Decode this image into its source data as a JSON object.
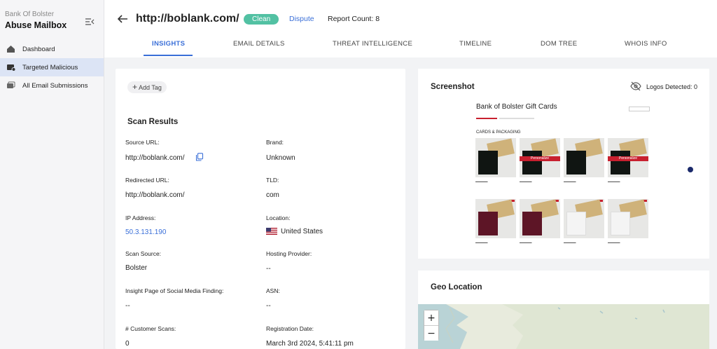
{
  "sidebar": {
    "org": "Bank Of Bolster",
    "app_title": "Abuse Mailbox",
    "items": [
      {
        "label": "Dashboard"
      },
      {
        "label": "Targeted Malicious"
      },
      {
        "label": "All Email Submissions"
      }
    ]
  },
  "header": {
    "url": "http://boblank.com/",
    "status_badge": "Clean",
    "dispute": "Dispute",
    "report_count": "Report Count: 8"
  },
  "tabs": [
    {
      "label": "INSIGHTS"
    },
    {
      "label": "EMAIL DETAILS"
    },
    {
      "label": "THREAT INTELLIGENCE"
    },
    {
      "label": "TIMELINE"
    },
    {
      "label": "DOM TREE"
    },
    {
      "label": "WHOIS INFO"
    }
  ],
  "insights": {
    "add_tag": "Add Tag",
    "scan_results_title": "Scan Results",
    "fields": {
      "source_url": {
        "label": "Source URL:",
        "value": "http://boblank.com/"
      },
      "brand": {
        "label": "Brand:",
        "value": "Unknown"
      },
      "redirected_url": {
        "label": "Redirected URL:",
        "value": "http://boblank.com/"
      },
      "tld": {
        "label": "TLD:",
        "value": "com"
      },
      "ip_address": {
        "label": "IP Address:",
        "value": "50.3.131.190"
      },
      "location": {
        "label": "Location:",
        "value": "United States"
      },
      "scan_source": {
        "label": "Scan Source:",
        "value": "Bolster"
      },
      "hosting_provider": {
        "label": "Hosting Provider:",
        "value": "--"
      },
      "insight_page": {
        "label": "Insight Page of Social Media Finding:",
        "value": "--"
      },
      "asn": {
        "label": "ASN:",
        "value": "--"
      },
      "customer_scans": {
        "label": "# Customer Scans:",
        "value": "0"
      },
      "registration_date": {
        "label": "Registration Date:",
        "value": "March 3rd 2024, 5:41:11 pm"
      }
    }
  },
  "screenshot": {
    "title": "Screenshot",
    "logos_detected": "Logos Detected: 0",
    "thumb_title": "Bank of Bolster Gift Cards",
    "thumb_section": "CARDS & PACKAGING",
    "ribbon_text": "Personalize"
  },
  "geo": {
    "title": "Geo Location",
    "zoom_in": "+",
    "zoom_out": "−"
  },
  "colors": {
    "accent": "#3a6fd8",
    "clean_badge": "#52c1a3",
    "active_nav_bg": "#dce4f5"
  }
}
